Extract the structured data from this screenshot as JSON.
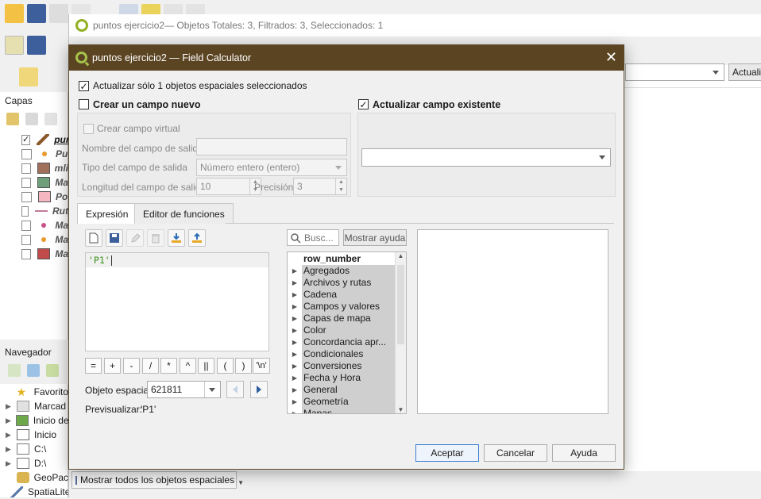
{
  "attribute_window": {
    "title": "puntos ejercicio2— Objetos Totales: 3, Filtrados: 3, Seleccionados: 1",
    "update_button": "Actualiz",
    "show_features": "Mostrar todos los objetos espaciales"
  },
  "layers_panel": {
    "title": "Capas",
    "items": [
      {
        "name": "pun",
        "checked": true
      },
      {
        "name": "Pu",
        "checked": false
      },
      {
        "name": "mli",
        "checked": false
      },
      {
        "name": "Ma",
        "checked": false
      },
      {
        "name": "Po",
        "checked": false
      },
      {
        "name": "Rut",
        "checked": false
      },
      {
        "name": "Ma",
        "checked": false
      },
      {
        "name": "Ma",
        "checked": false
      },
      {
        "name": "Ma",
        "checked": false
      }
    ]
  },
  "browser_panel": {
    "title": "Navegador",
    "items": [
      "Favorito",
      "Marcad",
      "Inicio de",
      "Inicio",
      "C:\\",
      "D:\\",
      "GeoPac",
      "SpatiaLite"
    ]
  },
  "dialog": {
    "title": "puntos ejercicio2 — Field Calculator",
    "update_selected_only": "Actualizar sólo 1 objetos espaciales seleccionados",
    "create_new_field": "Crear un campo nuevo",
    "update_existing_field": "Actualizar campo existente",
    "create_virtual_field": "Crear campo virtual",
    "output_field_name_label": "Nombre del campo de salida",
    "output_field_type_label": "Tipo del campo de salida",
    "output_field_type_value": "Número entero (entero)",
    "output_field_length_label": "Longitud del campo de salida",
    "output_field_length_value": "10",
    "precision_label": "Precisión",
    "precision_value": "3",
    "tabs": {
      "expression": "Expresión",
      "function_editor": "Editor de funciones"
    },
    "expression_text": "'P1'",
    "operators": [
      "=",
      "+",
      "-",
      "/",
      "*",
      "^",
      "||",
      "(",
      ")",
      "'\\n'"
    ],
    "feature_label": "Objeto espacial",
    "feature_value": "621811",
    "preview_label": "Previsualizar:",
    "preview_value": "'P1'",
    "search_placeholder": "Busc...",
    "show_help": "Mostrar ayuda",
    "function_groups": [
      "row_number",
      "Agregados",
      "Archivos y rutas",
      "Cadena",
      "Campos y valores",
      "Capas de mapa",
      "Color",
      "Concordancia apr...",
      "Condicionales",
      "Conversiones",
      "Fecha y Hora",
      "General",
      "Geometría",
      "Mapas"
    ],
    "buttons": {
      "ok": "Aceptar",
      "cancel": "Cancelar",
      "help": "Ayuda"
    },
    "close_glyph": "✕"
  },
  "colors": {
    "title_bar": "#5b4422",
    "accent_button_border": "#3c7fd1",
    "expression_green": "#3a8f1a",
    "function_item_bg": "#cfcfcf"
  }
}
